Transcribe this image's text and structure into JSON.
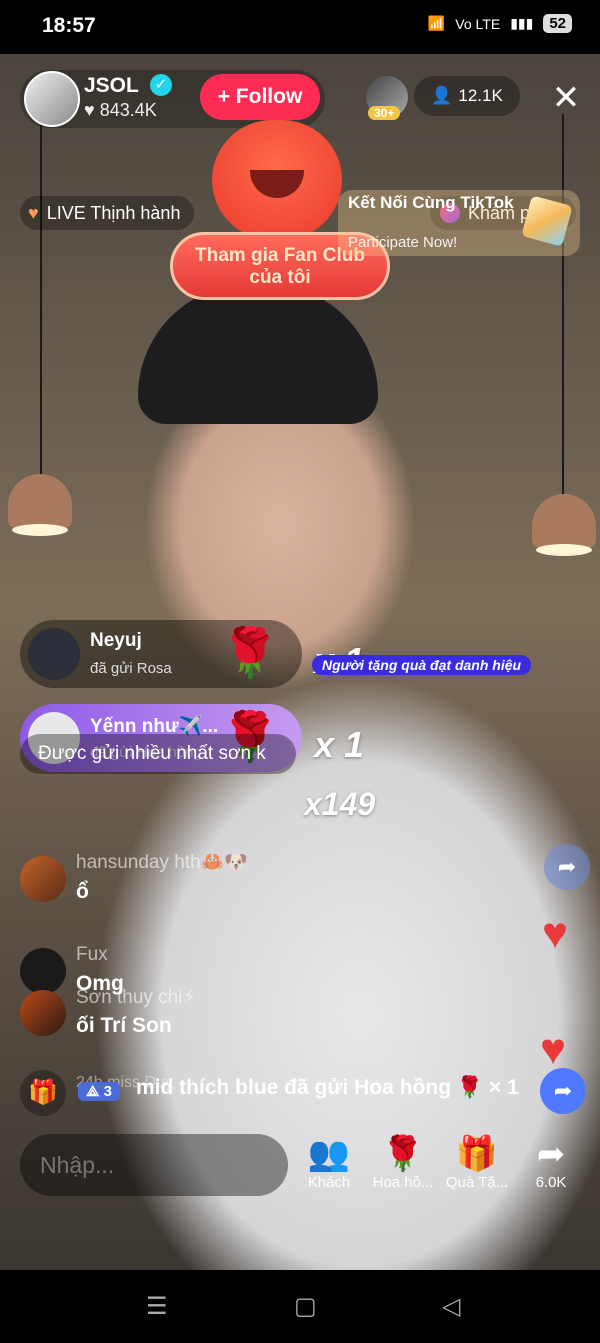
{
  "status": {
    "time": "18:57",
    "net": "Vo LTE",
    "battery": "52"
  },
  "host": {
    "name": "JSOL",
    "likes": "843.4K",
    "follow_label": "+ Follow"
  },
  "top_right": {
    "rank_badge": "30+",
    "viewers": "12.1K"
  },
  "tags": {
    "trending": "LIVE Thịnh hành",
    "explore": "Khám phá"
  },
  "fan_club": {
    "line1": "Tham gia Fan Club",
    "line2": "của tôi"
  },
  "promo": {
    "title": "Kết Nối Cùng TikTok",
    "subtitle": "Participate Now!"
  },
  "gifts": [
    {
      "user": "Neyuj",
      "action": "đã gửi Rosa",
      "count": "x 1"
    },
    {
      "user": "Yếnn như✈️...",
      "action": "đã gửi Hoa hồng",
      "count": "x 1"
    }
  ],
  "achiever_badge": "Người tặng quà đạt danh hiệu",
  "most_sent": {
    "text": "Được gửi nhiều nhất sơn k",
    "count": "x149"
  },
  "comments": [
    {
      "user": "hansunday hth🦀🐶",
      "text": "ổ"
    },
    {
      "user": "Fux",
      "text": "Omg"
    },
    {
      "user": "Sơn thuy chi⚡",
      "text": "ối Trí Son"
    },
    {
      "user": "24h miss Duy",
      "text": ""
    }
  ],
  "ticker": {
    "rank": "3",
    "text": "mid thích blue đã gửi Hoa hồng 🌹 × 1"
  },
  "bottom": {
    "input_placeholder": "Nhập...",
    "actions": [
      {
        "label": "Khách",
        "icon": "guests-icon"
      },
      {
        "label": "Hoa hồ...",
        "icon": "rose-icon"
      },
      {
        "label": "Quà Tặ...",
        "icon": "gift-icon"
      },
      {
        "label": "6.0K",
        "icon": "share-icon"
      }
    ]
  },
  "colors": {
    "follow": "#fe2c55",
    "achiever": "#3a2be0",
    "share": "#4f79ff"
  }
}
